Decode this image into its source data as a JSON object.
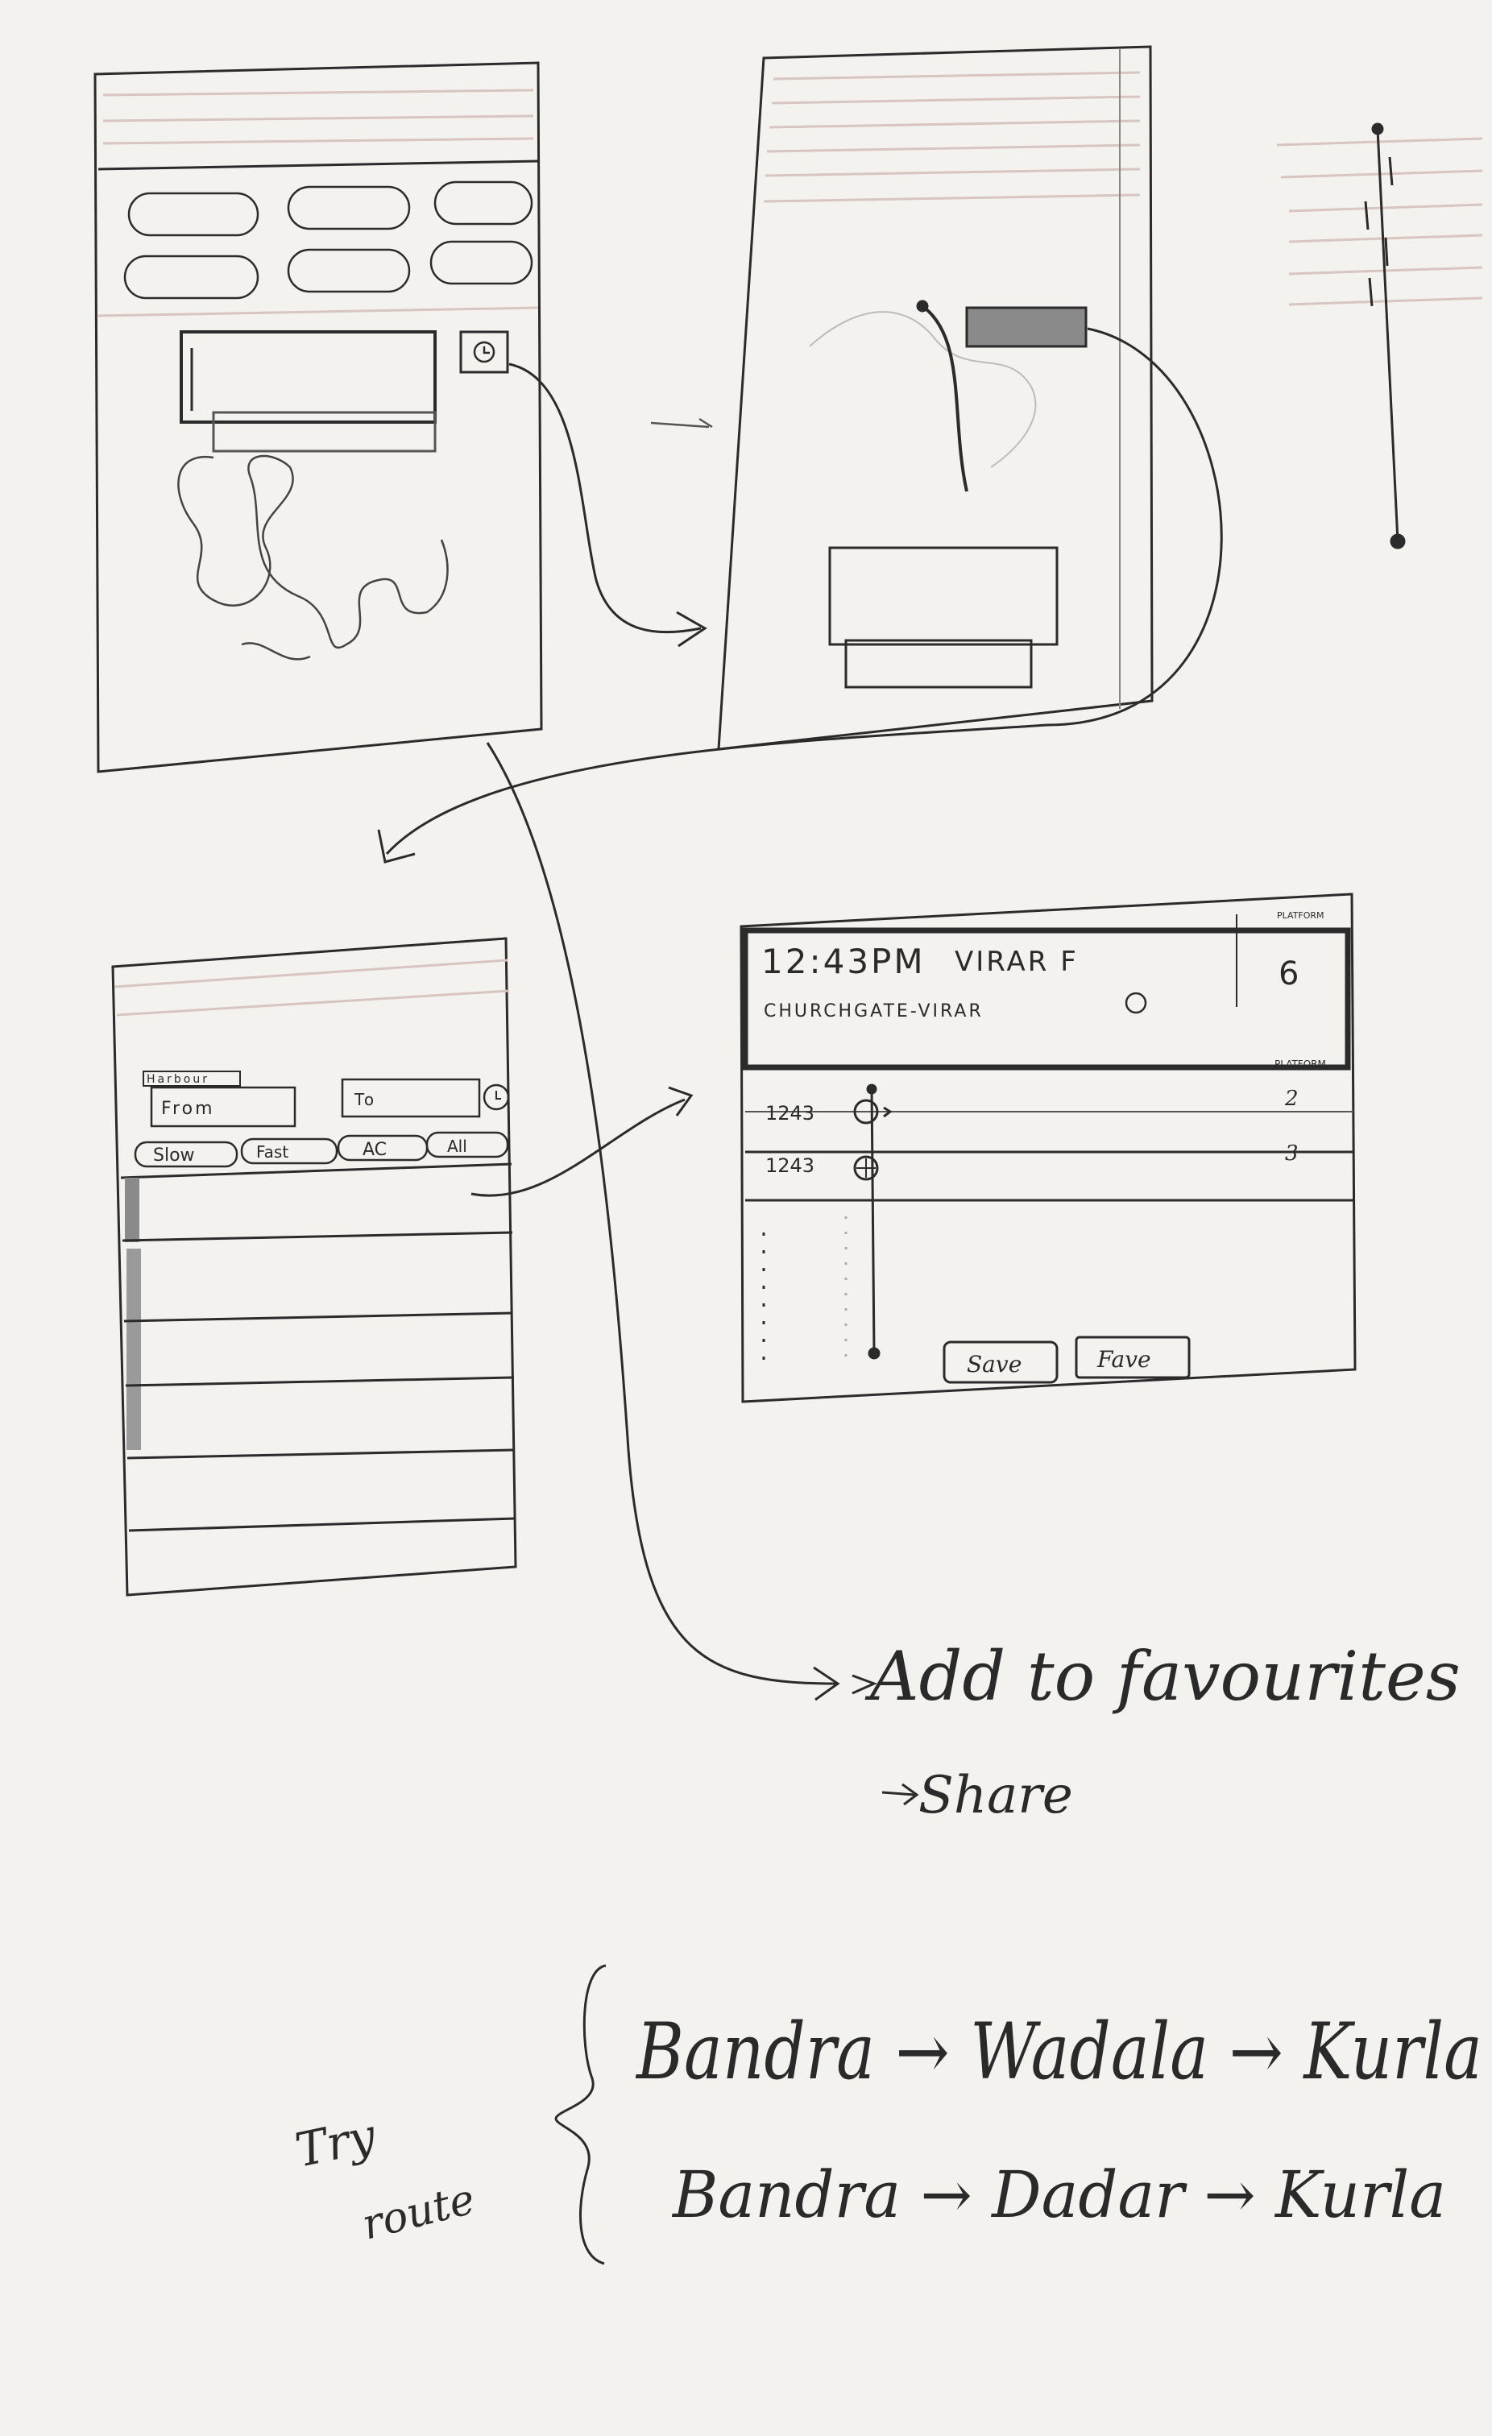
{
  "page": {
    "ink": "#2b2b2b",
    "paper": "#f4f2ee",
    "faint_line": "#d9c7c2",
    "shade": "#8a8a8a"
  },
  "screen_search": {
    "label": "Harbour",
    "from_placeholder": "From",
    "to_placeholder": "To",
    "clock_icon": "clock-icon",
    "filters": [
      "Slow",
      "Fast",
      "AC",
      "All"
    ]
  },
  "screen_detail": {
    "time": "12:43PM",
    "train": "VIRAR F",
    "route": "CHURCHGATE-VIRAR",
    "platform_label": "PLATFORM",
    "platform_value": "6",
    "list_header": "PLATFORM",
    "rows": [
      {
        "time": "1243",
        "platform": "2"
      },
      {
        "time": "1243",
        "platform": "3"
      }
    ],
    "buttons": [
      "Save",
      "Fave"
    ]
  },
  "notes": {
    "actions": [
      "Add to favourites",
      "Share"
    ],
    "try_label": [
      "Try",
      "route"
    ],
    "routes": [
      "Bandra → Wadala → Kurla",
      "Bandra → Dadar → Kurla"
    ]
  }
}
